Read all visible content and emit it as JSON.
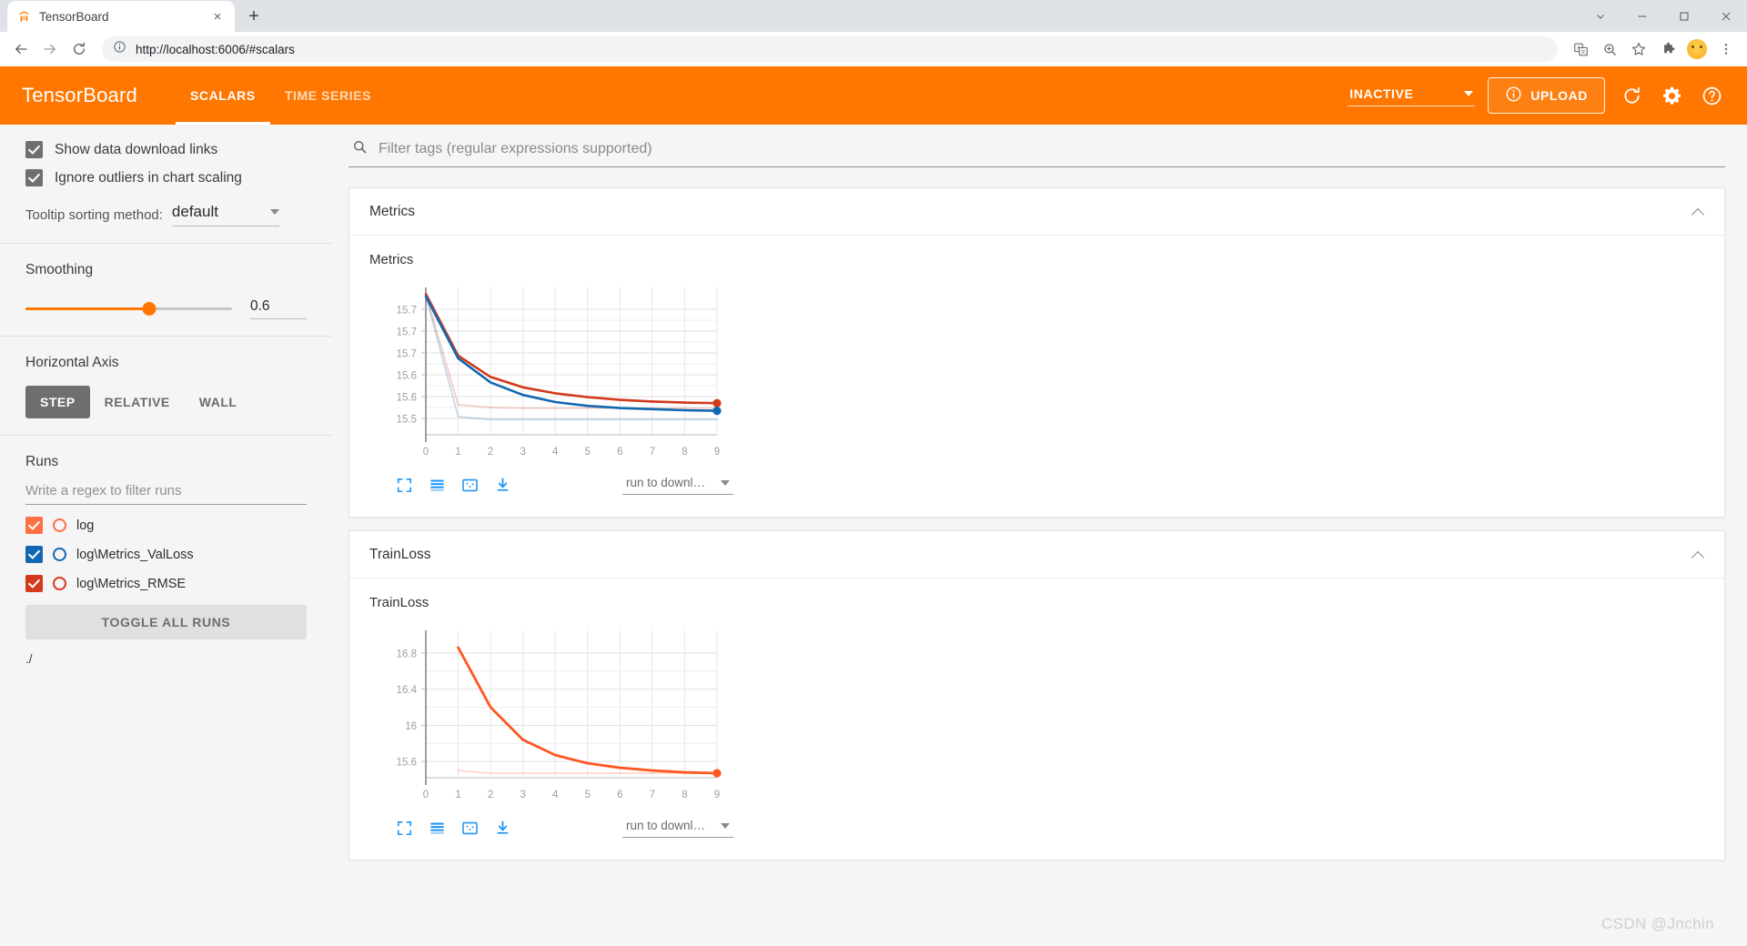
{
  "browser": {
    "tab": {
      "title": "TensorBoard",
      "favicon_name": "tensorboard-favicon",
      "close_label": "×"
    },
    "newtab_label": "+",
    "window": {
      "tabsearch": "tab-search",
      "minimize": "−",
      "maximize": "□",
      "close": "✕"
    },
    "nav": {
      "back": "←",
      "forward": "→",
      "reload": "↻"
    },
    "omnibox": {
      "info_icon": "info-icon",
      "url": "http://localhost:6006/#scalars"
    },
    "actions": [
      "translate-icon",
      "zoom-icon",
      "bookmark-star-icon",
      "extensions-puzzle-icon",
      "profile-avatar",
      "browser-menu-icon"
    ]
  },
  "header": {
    "brand": "TensorBoard",
    "tabs": [
      {
        "label": "SCALARS",
        "active": true
      },
      {
        "label": "TIME SERIES",
        "active": false
      }
    ],
    "status": "INACTIVE",
    "upload_label": "UPLOAD",
    "icons": [
      "reload-icon",
      "settings-gear-icon",
      "help-circle-icon"
    ],
    "bg_color": "#ff7700"
  },
  "sidebar": {
    "checkboxes": [
      {
        "label": "Show data download links",
        "checked": true
      },
      {
        "label": "Ignore outliers in chart scaling",
        "checked": true
      }
    ],
    "tooltip": {
      "label": "Tooltip sorting method:",
      "value": "default"
    },
    "smoothing": {
      "title": "Smoothing",
      "value": "0.6",
      "percent": 60
    },
    "horizontal_axis": {
      "title": "Horizontal Axis",
      "options": [
        {
          "label": "STEP",
          "active": true
        },
        {
          "label": "RELATIVE",
          "active": false
        },
        {
          "label": "WALL",
          "active": false
        }
      ]
    },
    "runs": {
      "title": "Runs",
      "filter_placeholder": "Write a regex to filter runs",
      "items": [
        {
          "name": "log",
          "color": "#ff7043",
          "checked": true
        },
        {
          "name": "log\\Metrics_ValLoss",
          "color": "#1267b1",
          "checked": true
        },
        {
          "name": "log\\Metrics_RMSE",
          "color": "#d3391a",
          "checked": true
        }
      ],
      "toggle_all_label": "TOGGLE ALL RUNS",
      "path": "./"
    }
  },
  "main": {
    "search_placeholder": "Filter tags (regular expressions supported)",
    "cards": [
      {
        "header": "Metrics",
        "chart_title": "Metrics"
      },
      {
        "header": "TrainLoss",
        "chart_title": "TrainLoss"
      }
    ],
    "chart_toolbar": {
      "icons": [
        "expand-fullscreen-icon",
        "data-series-lines-icon",
        "fit-domain-icon",
        "download-icon"
      ],
      "download_label": "run to downl…"
    }
  },
  "watermark": "CSDN @Jnchin",
  "chart_data": [
    {
      "type": "line",
      "title": "Metrics",
      "xlabel": "",
      "ylabel": "",
      "x": [
        0,
        1,
        2,
        3,
        4,
        5,
        6,
        7,
        8,
        9
      ],
      "xticks": [
        "0",
        "1",
        "2",
        "3",
        "4",
        "5",
        "6",
        "7",
        "8",
        "9"
      ],
      "yticks": [
        "15.7",
        "15.7",
        "15.7",
        "15.6",
        "15.6",
        "15.5"
      ],
      "ytick_values": [
        15.72,
        15.68,
        15.64,
        15.6,
        15.56,
        15.52
      ],
      "xlim": [
        0,
        9
      ],
      "ylim": [
        15.49,
        15.76
      ],
      "grid": true,
      "legend": "none",
      "series": [
        {
          "name": "log\\Metrics_RMSE smoothed",
          "color": "#d3391a",
          "width": 2.6,
          "opacity": 1,
          "values": [
            15.748,
            15.635,
            15.596,
            15.577,
            15.566,
            15.559,
            15.554,
            15.551,
            15.549,
            15.548
          ]
        },
        {
          "name": "log\\Metrics_ValLoss smoothed",
          "color": "#1267b1",
          "width": 2.6,
          "opacity": 1,
          "values": [
            15.744,
            15.63,
            15.586,
            15.563,
            15.55,
            15.543,
            15.539,
            15.537,
            15.535,
            15.534
          ]
        },
        {
          "name": "log\\Metrics_RMSE raw",
          "color": "#d3391a",
          "width": 1.8,
          "opacity": 0.25,
          "values": [
            15.748,
            15.545,
            15.54,
            15.539,
            15.539,
            15.539,
            15.539,
            15.539,
            15.539,
            15.539
          ]
        },
        {
          "name": "log\\Metrics_ValLoss raw",
          "color": "#1267b1",
          "width": 1.8,
          "opacity": 0.25,
          "values": [
            15.744,
            15.523,
            15.518,
            15.518,
            15.518,
            15.518,
            15.518,
            15.518,
            15.518,
            15.518
          ]
        }
      ],
      "markers": [
        {
          "series": "log\\Metrics_RMSE smoothed",
          "x": 9,
          "y": 15.548,
          "color": "#d3391a"
        },
        {
          "series": "log\\Metrics_ValLoss smoothed",
          "x": 9,
          "y": 15.534,
          "color": "#1267b1"
        }
      ]
    },
    {
      "type": "line",
      "title": "TrainLoss",
      "xlabel": "",
      "ylabel": "",
      "x": [
        0,
        1,
        2,
        3,
        4,
        5,
        6,
        7,
        8,
        9
      ],
      "xticks": [
        "0",
        "1",
        "2",
        "3",
        "4",
        "5",
        "6",
        "7",
        "8",
        "9"
      ],
      "yticks": [
        "16.8",
        "16.4",
        "16",
        "15.6"
      ],
      "ytick_values": [
        16.8,
        16.4,
        16.0,
        15.6
      ],
      "xlim": [
        0,
        9
      ],
      "ylim": [
        15.42,
        17.05
      ],
      "grid": true,
      "legend": "none",
      "series": [
        {
          "name": "log smoothed",
          "color": "#ff5722",
          "width": 2.8,
          "opacity": 1,
          "values": [
            null,
            16.86,
            16.2,
            15.84,
            15.67,
            15.58,
            15.53,
            15.5,
            15.48,
            15.47
          ]
        },
        {
          "name": "log raw",
          "color": "#ff5722",
          "width": 1.8,
          "opacity": 0.25,
          "values": [
            null,
            15.5,
            15.47,
            15.47,
            15.47,
            15.47,
            15.47,
            15.47,
            15.47,
            15.47
          ]
        }
      ],
      "markers": [
        {
          "series": "log smoothed",
          "x": 9,
          "y": 15.47,
          "color": "#ff5722"
        }
      ]
    }
  ]
}
